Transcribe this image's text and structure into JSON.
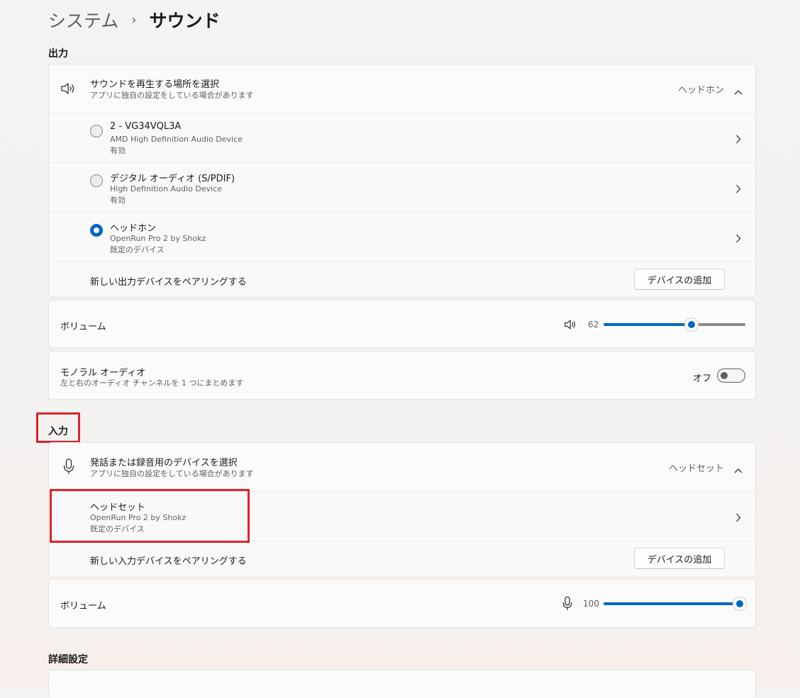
{
  "breadcrumb": {
    "parent": "システム",
    "separator": "›",
    "current": "サウンド"
  },
  "output": {
    "section_title": "出力",
    "choose": {
      "title": "サウンドを再生する場所を選択",
      "subtitle": "アプリに独自の設定をしている場合があります",
      "current_value": "ヘッドホン"
    },
    "devices": [
      {
        "name": "2 - VG34VQL3A",
        "driver": "AMD High Definition Audio Device",
        "status": "有効",
        "selected": false
      },
      {
        "name": "デジタル オーディオ (S/PDIF)",
        "driver": "High Definition Audio Device",
        "status": "有効",
        "selected": false
      },
      {
        "name": "ヘッドホン",
        "driver": "OpenRun Pro 2 by Shokz",
        "status": "既定のデバイス",
        "selected": true
      }
    ],
    "pair": {
      "label": "新しい出力デバイスをペアリングする",
      "button": "デバイスの追加"
    },
    "volume": {
      "label": "ボリューム",
      "value": "62",
      "level": 0.62
    },
    "mono": {
      "title": "モノラル オーディオ",
      "subtitle": "左と右のオーディオ チャンネルを 1 つにまとめます",
      "state": "オフ"
    }
  },
  "input": {
    "section_title": "入力",
    "choose": {
      "title": "発話または録音用のデバイスを選択",
      "subtitle": "アプリに独自の設定をしている場合があります",
      "current_value": "ヘッドセット"
    },
    "devices": [
      {
        "name": "ヘッドセット",
        "driver": "OpenRun Pro 2 by Shokz",
        "status": "既定のデバイス"
      }
    ],
    "pair": {
      "label": "新しい入力デバイスをペアリングする",
      "button": "デバイスの追加"
    },
    "volume": {
      "label": "ボリューム",
      "value": "100",
      "level": 1.0
    }
  },
  "advanced": {
    "section_title": "詳細設定"
  },
  "colors": {
    "accent": "#0067c0",
    "highlight": "#e0232b"
  },
  "icons": {
    "output_device": "speaker-icon",
    "volume_output": "speaker-icon",
    "input_device": "microphone-icon",
    "volume_input": "microphone-icon",
    "expand": "chevron-up-icon",
    "row": "chevron-right-icon"
  }
}
